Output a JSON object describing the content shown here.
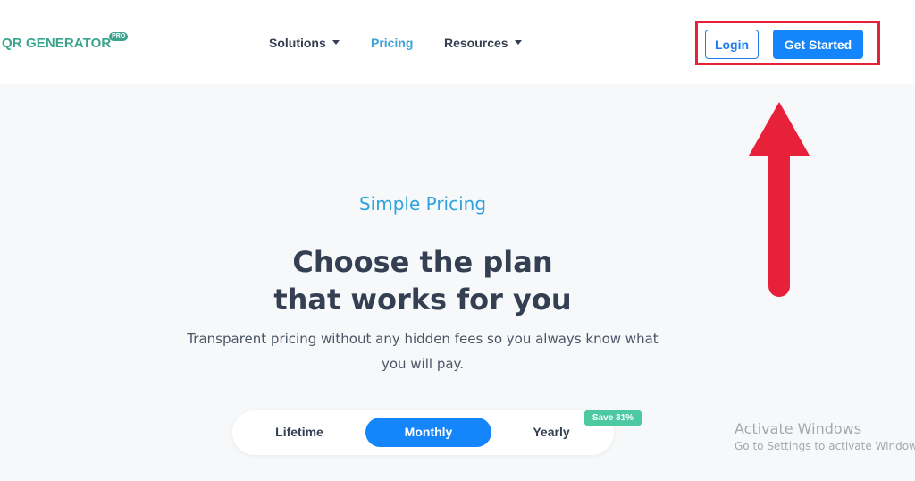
{
  "brand": {
    "name": "QR GENERATOR",
    "badge": "PRO",
    "color": "#3aa48d"
  },
  "nav": {
    "items": [
      {
        "label": "Solutions",
        "has_dropdown": true
      },
      {
        "label": "Pricing",
        "has_dropdown": false,
        "active": true
      },
      {
        "label": "Resources",
        "has_dropdown": true
      }
    ]
  },
  "header_actions": {
    "login_label": "Login",
    "get_started_label": "Get Started"
  },
  "annotation": {
    "highlight_color": "#e8213a",
    "arrow_icon": "up-arrow-icon"
  },
  "hero": {
    "eyebrow": "Simple Pricing",
    "headline_line1": "Choose the plan",
    "headline_line2": "that works for you",
    "subtext": "Transparent pricing without any hidden fees so you always know what you will pay."
  },
  "billing_toggle": {
    "options": [
      {
        "label": "Lifetime",
        "active": false
      },
      {
        "label": "Monthly",
        "active": true
      },
      {
        "label": "Yearly",
        "active": false
      }
    ],
    "save_badge": "Save 31%"
  },
  "os_watermark": {
    "line1": "Activate Windows",
    "line2": "Go to Settings to activate Windows."
  },
  "colors": {
    "accent_blue": "#1485fb",
    "eyebrow_blue": "#2ea3dd",
    "badge_green": "#4cc9a0",
    "text_dark": "#343f52"
  }
}
